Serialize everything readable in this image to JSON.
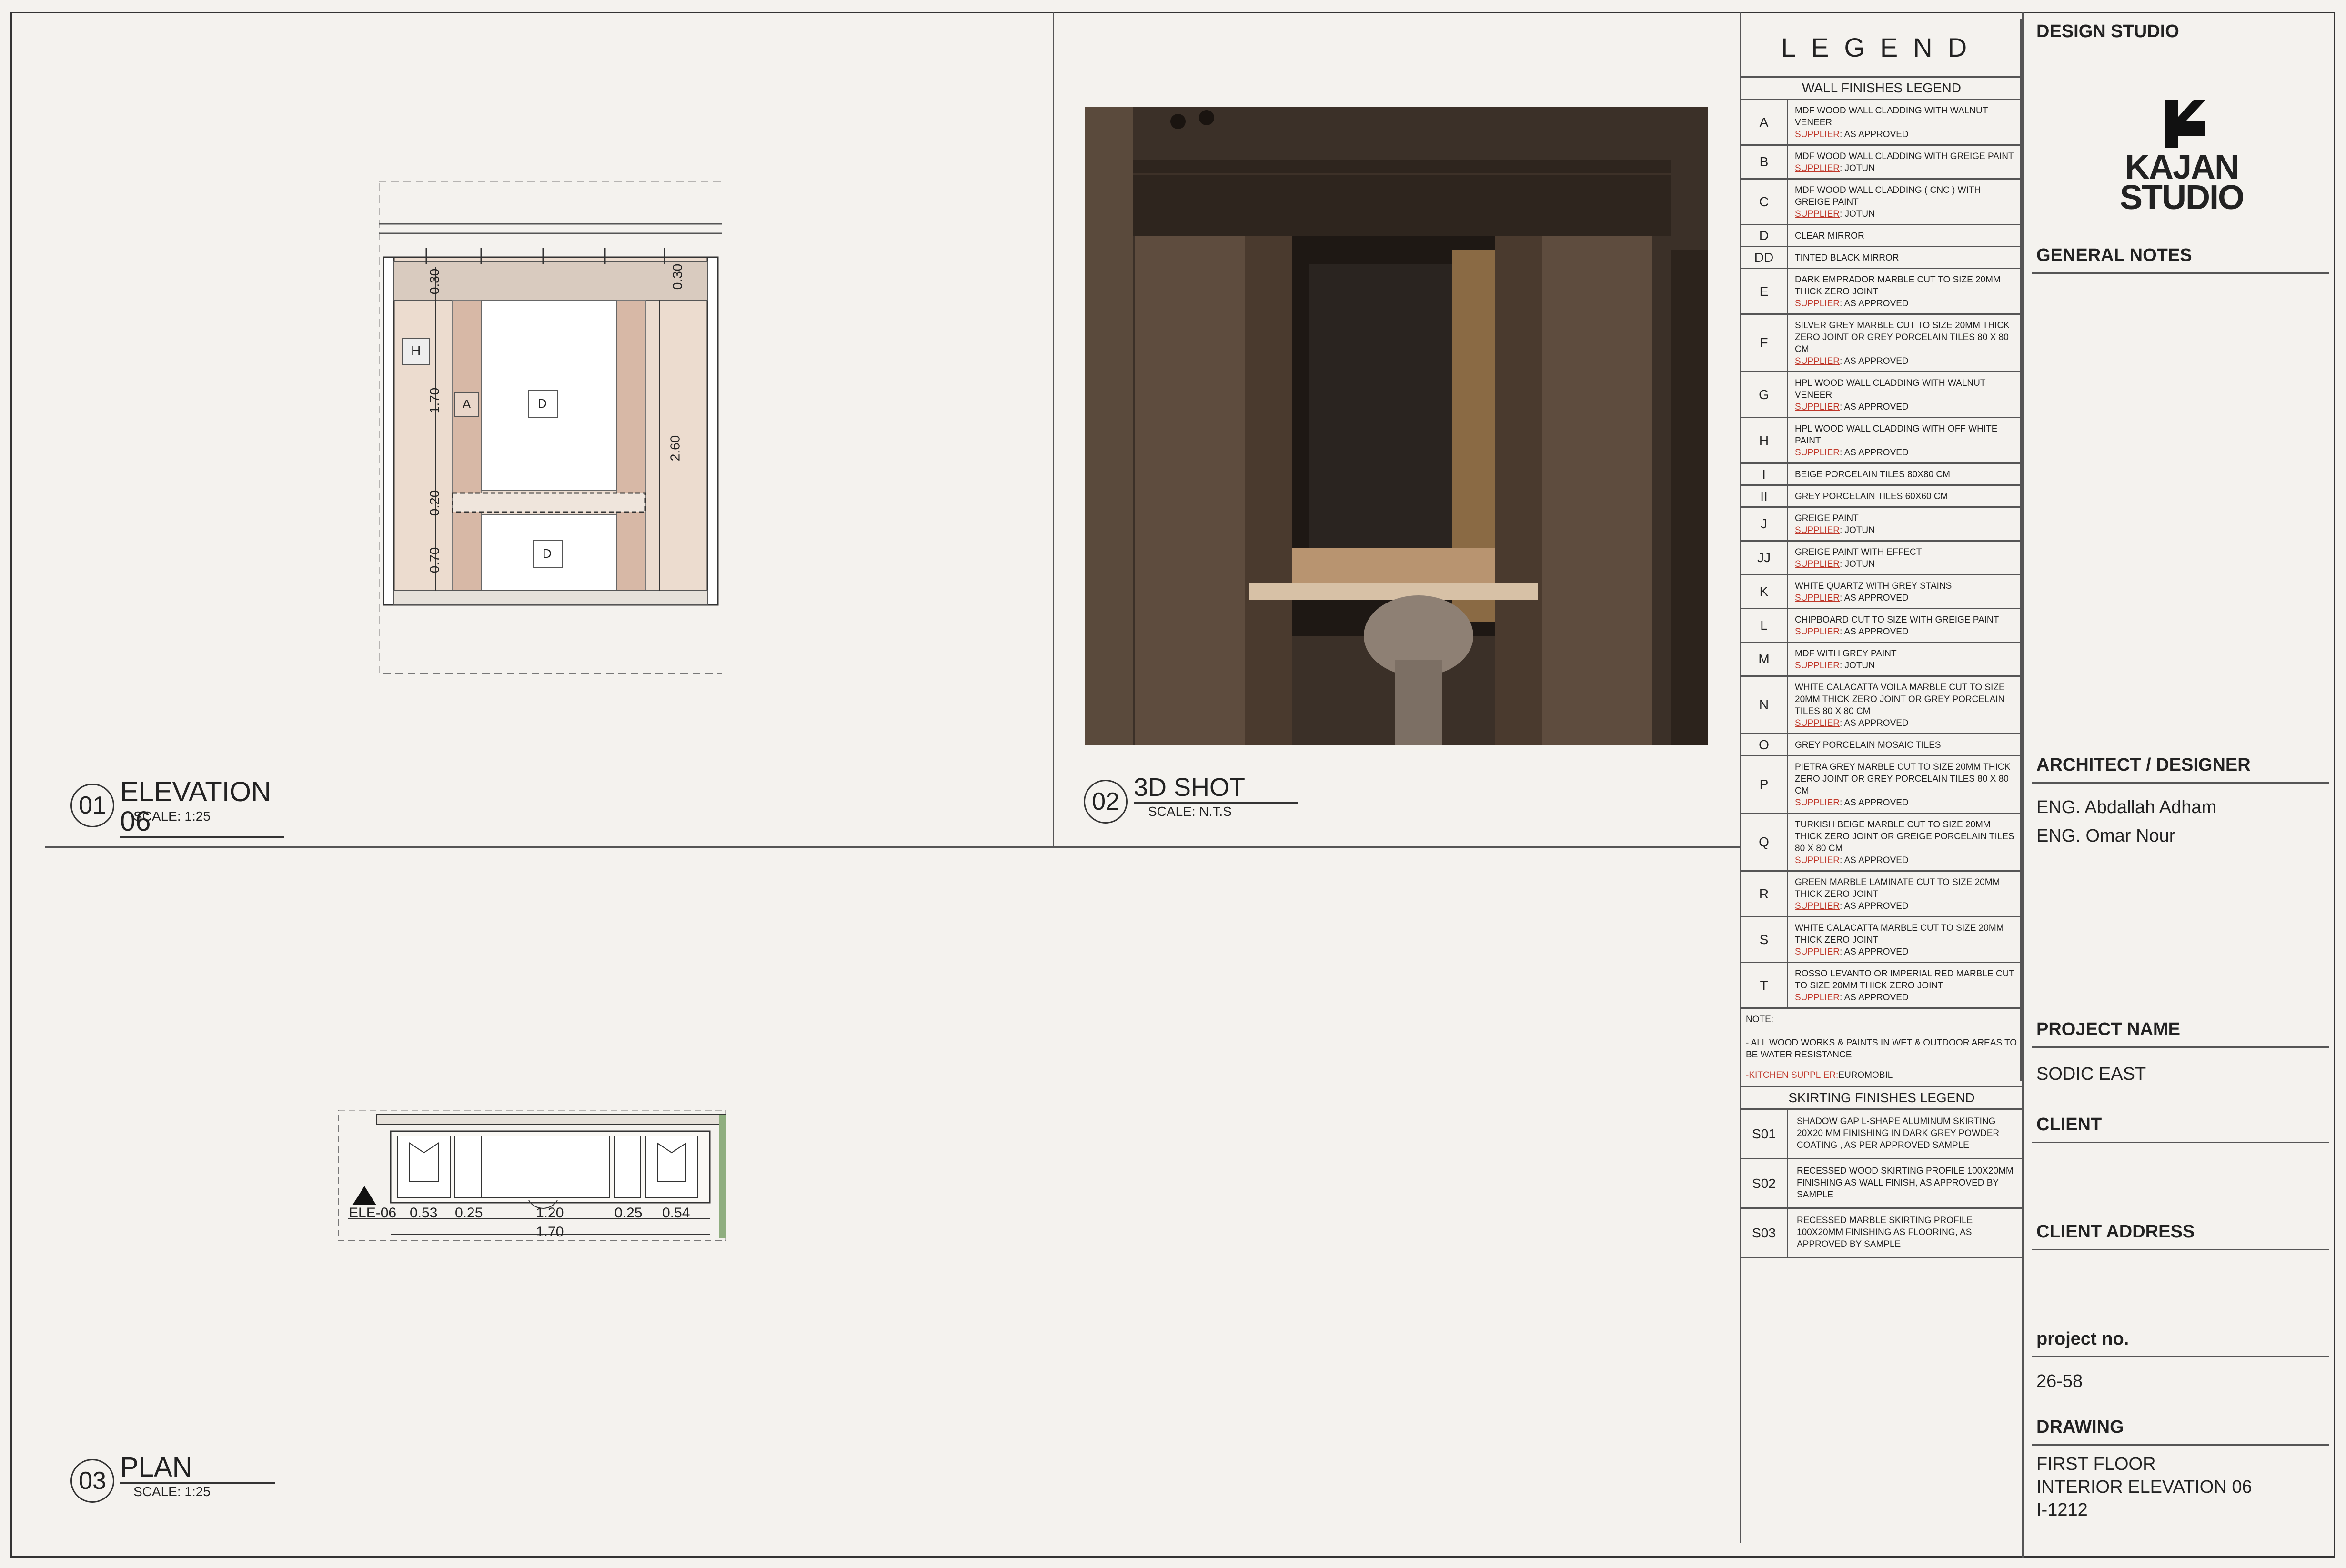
{
  "views": [
    {
      "number": "01",
      "title": "ELEVATION 06",
      "scale": "SCALE: 1:25"
    },
    {
      "number": "02",
      "title": "3D SHOT",
      "scale": "SCALE: N.T.S"
    },
    {
      "number": "03",
      "title": "PLAN",
      "scale": "SCALE: 1:25"
    }
  ],
  "elevation": {
    "dims_left": [
      "0.30",
      "1.70",
      "0.20",
      "0.70"
    ],
    "dim_right": "2.60",
    "dim_top_right": "0.30",
    "tags": [
      "H",
      "A",
      "D",
      "D"
    ]
  },
  "plan": {
    "tag": "ELE-06",
    "dims": [
      "0.53",
      "0.25",
      "1.20",
      "0.25",
      "0.54"
    ],
    "total": "1.70"
  },
  "legend": {
    "title": "LEGEND",
    "wall_heading": "WALL FINISHES LEGEND",
    "supplier_label": "SUPPLIER",
    "items": [
      {
        "code": "A",
        "desc": "MDF WOOD WALL CLADDING WITH WALNUT VENEER",
        "supplier": ": AS APPROVED"
      },
      {
        "code": "B",
        "desc": "MDF WOOD WALL CLADDING WITH  GREIGE PAINT",
        "supplier": ": JOTUN"
      },
      {
        "code": "C",
        "desc": "MDF WOOD WALL CLADDING ( CNC ) WITH GREIGE PAINT",
        "supplier": ": JOTUN"
      },
      {
        "code": "D",
        "desc": "CLEAR MIRROR",
        "supplier": ""
      },
      {
        "code": "DD",
        "desc": "TINTED BLACK MIRROR",
        "supplier": ""
      },
      {
        "code": "E",
        "desc": "DARK EMPRADOR MARBLE CUT TO SIZE 20MM THICK ZERO JOINT",
        "supplier": ": AS APPROVED"
      },
      {
        "code": "F",
        "desc": "SILVER GREY MARBLE CUT TO SIZE 20MM THICK ZERO JOINT OR GREY PORCELAIN TILES 80 X 80 CM",
        "supplier": ": AS APPROVED"
      },
      {
        "code": "G",
        "desc": "HPL WOOD WALL CLADDING WITH WALNUT VENEER",
        "supplier": ": AS APPROVED"
      },
      {
        "code": "H",
        "desc": "HPL WOOD WALL CLADDING WITH OFF WHITE PAINT",
        "supplier": ": AS APPROVED"
      },
      {
        "code": "I",
        "desc": "BEIGE PORCELAIN TILES  80X80 cm",
        "supplier": ""
      },
      {
        "code": "II",
        "desc": "GREY PORCELAIN TILES  60X60 cm",
        "supplier": ""
      },
      {
        "code": "J",
        "desc": "GREIGE PAINT",
        "supplier": ": JOTUN"
      },
      {
        "code": "JJ",
        "desc": "GREIGE PAINT WITH EFFECT",
        "supplier": ": JOTUN"
      },
      {
        "code": "K",
        "desc": "WHITE QUARTZ WITH GREY STAINS",
        "supplier": ": AS APPROVED"
      },
      {
        "code": "L",
        "desc": "CHIPBOARD  CUT TO SIZE WITH GREIGE PAINT",
        "supplier": ": AS APPROVED"
      },
      {
        "code": "M",
        "desc": "MDF WITH GREY PAINT",
        "supplier": ": JOTUN"
      },
      {
        "code": "N",
        "desc": "WHITE CALACATTA VOILA MARBLE CUT TO SIZE 20MM THICK ZERO JOINT OR GREY PORCELAIN TILES 80 X 80 CM",
        "supplier": ": AS APPROVED"
      },
      {
        "code": "O",
        "desc": "GREY PORCELAIN MOSAIC TILES",
        "supplier": ""
      },
      {
        "code": "P",
        "desc": "PIETRA GREY  MARBLE CUT TO SIZE 20MM THICK ZERO JOINT OR GREY PORCELAIN TILES 80 X 80 CM",
        "supplier": ": AS APPROVED"
      },
      {
        "code": "Q",
        "desc": "TURKISH BEIGE MARBLE CUT TO SIZE 20MM THICK ZERO JOINT OR GREIGE PORCELAIN TILES 80 X 80 CM",
        "supplier": ": AS APPROVED"
      },
      {
        "code": "R",
        "desc": "GREEN MARBLE LAMINATE CUT TO SIZE 20MM THICK ZERO JOINT",
        "supplier": ": AS APPROVED"
      },
      {
        "code": "S",
        "desc": "WHITE CALACATTA MARBLE CUT TO SIZE 20MM THICK ZERO JOINT",
        "supplier": ": AS APPROVED"
      },
      {
        "code": "T",
        "desc": "ROSSO LEVANTO OR IMPERIAL RED MARBLE CUT TO SIZE 20MM THICK ZERO JOINT",
        "supplier": ": AS APPROVED"
      }
    ],
    "note_label": "NOTE:",
    "note_text": "- ALL WOOD WORKS & PAINTS IN WET & OUTDOOR AREAS TO BE WATER RESISTANCE.",
    "kitchen_label": "-KITCHEN SUPPLIER:",
    "kitchen_value": "EUROMOBIL",
    "skirting_heading": "SKIRTING FINISHES LEGEND",
    "skirting": [
      {
        "code": "S01",
        "desc": "SHADOW GAP L-SHAPE ALUMINUM SKIRTING 20X20 MM FINISHING IN DARK GREY POWDER COATING , AS PER APPROVED SAMPLE"
      },
      {
        "code": "S02",
        "desc": "RECESSED WOOD SKIRTING PROFILE 100X20MM FINISHING AS WALL FINISH, AS APPROVED BY SAMPLE"
      },
      {
        "code": "S03",
        "desc": "RECESSED MARBLE SKIRTING PROFILE 100X20MM FINISHING AS FLOORING, AS APPROVED BY SAMPLE"
      }
    ]
  },
  "titleblock": {
    "studio_heading": "DESIGN STUDIO",
    "logo_line1": "KAJAN",
    "logo_line2": "STUDIO",
    "general_notes": "GENERAL NOTES",
    "architect_heading": "ARCHITECT / DESIGNER",
    "architects": [
      "ENG. Abdallah Adham",
      "ENG. Omar Nour"
    ],
    "project_heading": "PROJECT NAME",
    "project_name": "SODIC EAST",
    "client_heading": "CLIENT",
    "client_address_heading": "CLIENT ADDRESS",
    "project_no_heading": "project no.",
    "project_no": "26-58",
    "drawing_heading": "DRAWING",
    "drawing_lines": [
      "FIRST FLOOR",
      "INTERIOR ELEVATION 06",
      "I-1212"
    ]
  }
}
